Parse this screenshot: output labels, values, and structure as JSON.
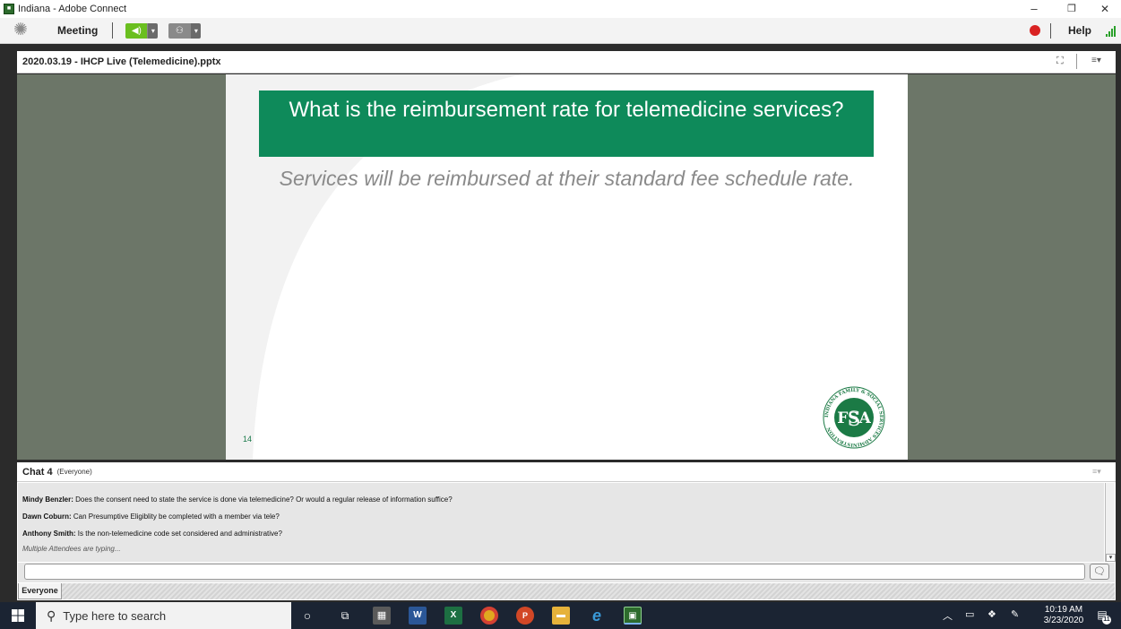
{
  "window": {
    "title": "Indiana - Adobe Connect",
    "controls": {
      "minimize": "–",
      "maximize": "❐",
      "close": "✕"
    }
  },
  "menubar": {
    "meeting_label": "Meeting",
    "help_label": "Help",
    "speaker_active_color": "#6abf1f"
  },
  "share_pod": {
    "title": "2020.03.19 - IHCP Live (Telemedicine).pptx",
    "fullscreen_icon": "⛶",
    "menu_icon": "≡▾"
  },
  "slide": {
    "title": "What is the reimbursement rate for telemedicine services?",
    "subtitle": "Services will be reimbursed at their standard fee schedule rate.",
    "page_number": "14",
    "logo_letters": "FSSA",
    "logo_ring_text": "INDIANA FAMILY & SOCIAL SERVICES ADMINISTRATION",
    "banner_color": "#0e8a5a"
  },
  "chat_pod": {
    "title": "Chat 4",
    "scope": "(Everyone)",
    "menu_icon": "≡▾",
    "messages": [
      {
        "author": "Mindy Benzler:",
        "text": "Does the consent need to state the service is done via telemedicine?  Or would a regular release of information suffice?"
      },
      {
        "author": "Dawn Coburn:",
        "text": "Can Presumptive Eligiblity be completed with a member via tele?"
      },
      {
        "author": "Anthony Smith:",
        "text": "Is the non-telemedicine code set considered and administrative?"
      }
    ],
    "typing_status": "Multiple Attendees are typing...",
    "input_placeholder": "",
    "send_icon": "💬",
    "tab_label": "Everyone"
  },
  "taskbar": {
    "search_placeholder": "Type here to search",
    "time": "10:19 AM",
    "date": "3/23/2020",
    "notification_count": "11"
  }
}
